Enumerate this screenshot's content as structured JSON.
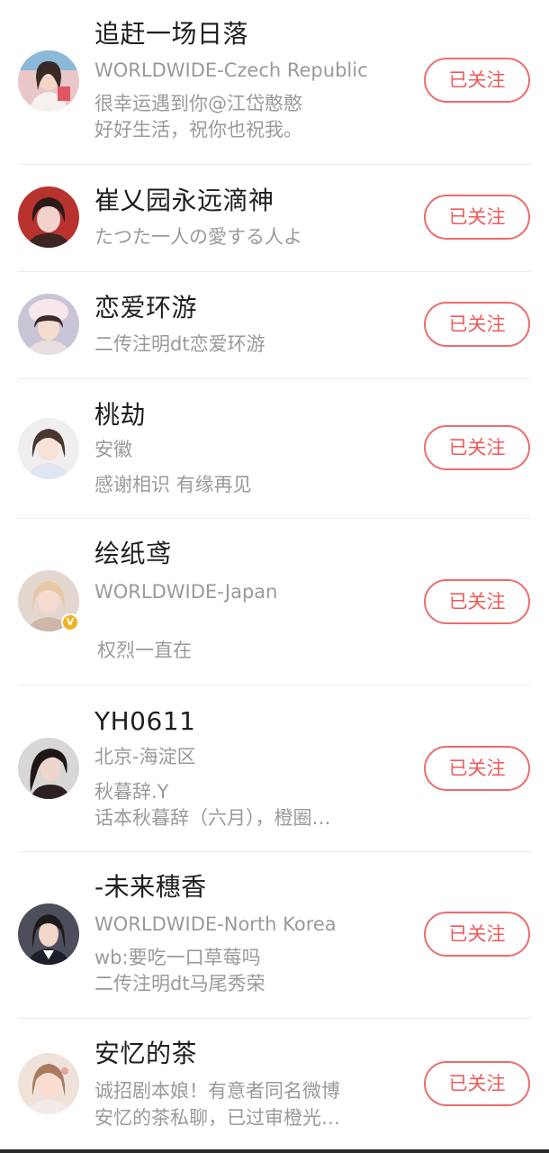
{
  "follow_list": {
    "follow_button_label": "已关注",
    "users": [
      {
        "name": "追赶一场日落",
        "lines": [
          "WORLDWIDE-Czech Republic",
          "很幸运遇到你@江岱憨憨",
          "好好生活，祝你也祝我。"
        ],
        "verified": false
      },
      {
        "name": "崔乂园永远滴神",
        "lines": [
          "たつた一人の愛する人よ"
        ],
        "verified": false
      },
      {
        "name": "恋爱环游",
        "lines": [
          "二传注明dt恋爱环游"
        ],
        "verified": false
      },
      {
        "name": "桃劫",
        "lines": [
          "安徽",
          "感谢相识 有缘再见"
        ],
        "verified": false
      },
      {
        "name": "绘纸鸢",
        "lines": [
          "WORLDWIDE-Japan",
          "",
          " 权烈一直在"
        ],
        "verified": true,
        "verified_mark": "V"
      },
      {
        "name": "YH0611",
        "lines": [
          "北京-海淀区",
          "秋暮辞.Y",
          "话本秋暮辞（六月），橙圈…"
        ],
        "verified": false
      },
      {
        "name": "-未来穗香",
        "lines": [
          "WORLDWIDE-North Korea",
          "wb:要吃一口草莓吗",
          "二传注明dt马尾秀荣"
        ],
        "verified": false
      },
      {
        "name": "安忆的茶",
        "lines": [
          "诚招剧本娘！有意者同名微博",
          "安忆的茶私聊，已过审橙光…"
        ],
        "verified": false
      }
    ]
  },
  "colors": {
    "accent": "#ee5a5a",
    "separator": "#ebebeb",
    "secondary_text": "#9a9a9a",
    "verified_badge": "#f0b21e"
  },
  "icons": {
    "avatar": "user-avatar-photo",
    "verified": "verified-badge-icon"
  }
}
